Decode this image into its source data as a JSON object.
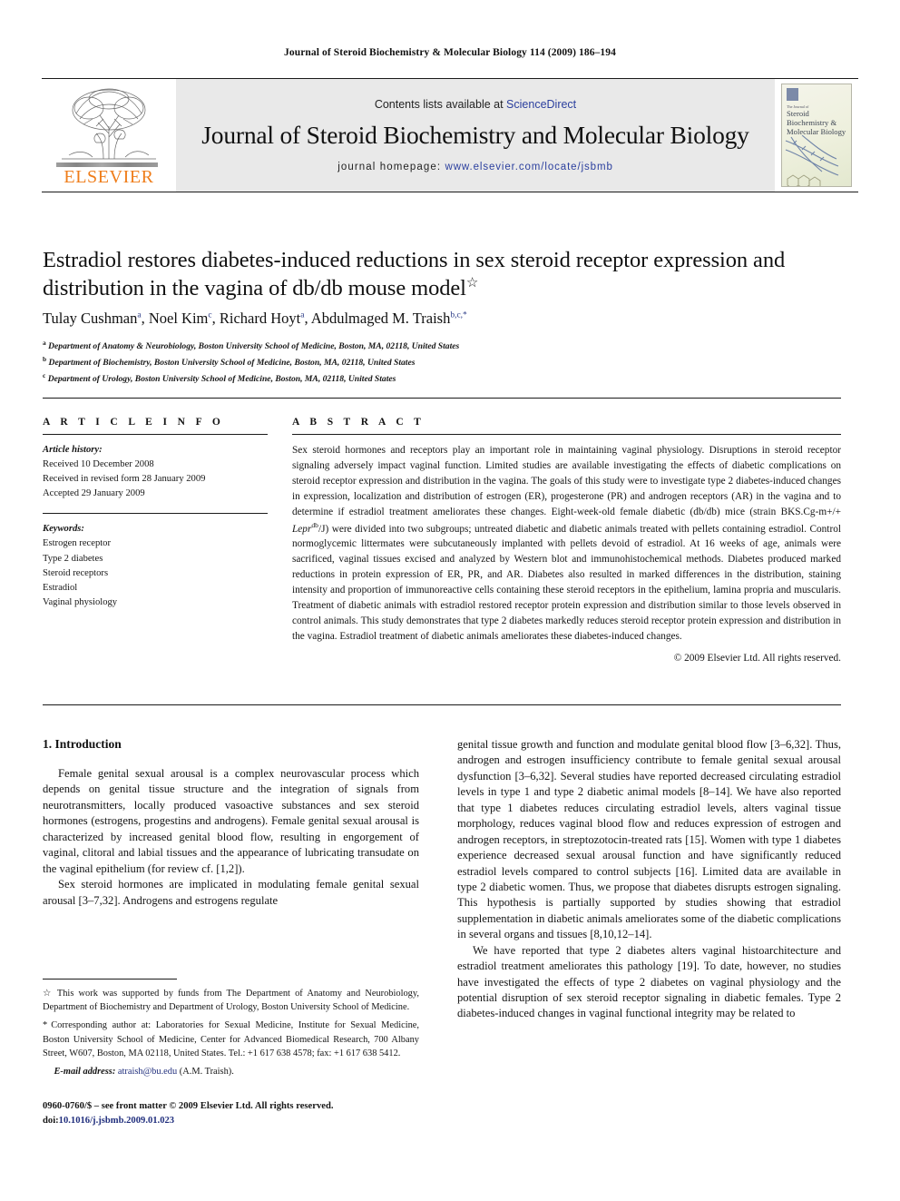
{
  "running_head": "Journal of Steroid Biochemistry & Molecular Biology 114 (2009) 186–194",
  "masthead": {
    "publisher": "ELSEVIER",
    "contents_prefix": "Contents lists available at ",
    "contents_link": "ScienceDirect",
    "journal_title": "Journal of Steroid Biochemistry and Molecular Biology",
    "homepage_prefix": "journal homepage: ",
    "homepage_url": "www.elsevier.com/locate/jsbmb",
    "cover": {
      "kicker": "The Journal of",
      "title": "Steroid Biochemistry & Molecular Biology"
    }
  },
  "article": {
    "title": "Estradiol restores diabetes-induced reductions in sex steroid receptor expression and distribution in the vagina of db/db mouse model",
    "title_footnote_marker": "☆",
    "authors": [
      {
        "name": "Tulay Cushman",
        "sup": "a"
      },
      {
        "name": "Noel Kim",
        "sup": "c"
      },
      {
        "name": "Richard Hoyt",
        "sup": "a"
      },
      {
        "name": "Abdulmaged M. Traish",
        "sup": "b,c,*"
      }
    ],
    "affiliations": [
      {
        "marker": "a",
        "text": "Department of Anatomy & Neurobiology, Boston University School of Medicine, Boston, MA, 02118, United States"
      },
      {
        "marker": "b",
        "text": "Department of Biochemistry, Boston University School of Medicine, Boston, MA, 02118, United States"
      },
      {
        "marker": "c",
        "text": "Department of Urology, Boston University School of Medicine, Boston, MA, 02118, United States"
      }
    ]
  },
  "article_info": {
    "heading": "A R T I C L E   I N F O",
    "history_label": "Article history:",
    "history": [
      "Received 10 December 2008",
      "Received in revised form 28 January 2009",
      "Accepted 29 January 2009"
    ],
    "keywords_label": "Keywords:",
    "keywords": [
      "Estrogen receptor",
      "Type 2 diabetes",
      "Steroid receptors",
      "Estradiol",
      "Vaginal physiology"
    ]
  },
  "abstract": {
    "heading": "A B S T R A C T",
    "part1": "Sex steroid hormones and receptors play an important role in maintaining vaginal physiology. Disruptions in steroid receptor signaling adversely impact vaginal function. Limited studies are available investigating the effects of diabetic complications on steroid receptor expression and distribution in the vagina. The goals of this study were to investigate type 2 diabetes-induced changes in expression, localization and distribution of estrogen (ER), progesterone (PR) and androgen receptors (AR) in the vagina and to determine if estradiol treatment ameliorates these changes. Eight-week-old female diabetic (db/db) mice (strain BKS.Cg-m+/+ ",
    "strain_italic": "Lepr",
    "strain_sup": "db",
    "part2": "/J) were divided into two subgroups; untreated diabetic and diabetic animals treated with pellets containing estradiol. Control normoglycemic littermates were subcutaneously implanted with pellets devoid of estradiol. At 16 weeks of age, animals were sacrificed, vaginal tissues excised and analyzed by Western blot and immunohistochemical methods. Diabetes produced marked reductions in protein expression of ER, PR, and AR. Diabetes also resulted in marked differences in the distribution, staining intensity and proportion of immunoreactive cells containing these steroid receptors in the epithelium, lamina propria and muscularis. Treatment of diabetic animals with estradiol restored receptor protein expression and distribution similar to those levels observed in control animals. This study demonstrates that type 2 diabetes markedly reduces steroid receptor protein expression and distribution in the vagina. Estradiol treatment of diabetic animals ameliorates these diabetes-induced changes.",
    "copyright": "© 2009 Elsevier Ltd. All rights reserved."
  },
  "body": {
    "section_number_title": "1.  Introduction",
    "left_paragraphs": [
      "Female genital sexual arousal is a complex neurovascular process which depends on genital tissue structure and the integration of signals from neurotransmitters, locally produced vasoactive substances and sex steroid hormones (estrogens, progestins and androgens). Female genital sexual arousal is characterized by increased genital blood flow, resulting in engorgement of vaginal, clitoral and labial tissues and the appearance of lubricating transudate on the vaginal epithelium (for review cf. [1,2]).",
      "Sex steroid hormones are implicated in modulating female genital sexual arousal [3–7,32]. Androgens and estrogens regulate"
    ],
    "right_paragraphs": [
      "genital tissue growth and function and modulate genital blood flow [3–6,32]. Thus, androgen and estrogen insufficiency contribute to female genital sexual arousal dysfunction [3–6,32]. Several studies have reported decreased circulating estradiol levels in type 1 and type 2 diabetic animal models [8–14]. We have also reported that type 1 diabetes reduces circulating estradiol levels, alters vaginal tissue morphology, reduces vaginal blood flow and reduces expression of estrogen and androgen receptors, in streptozotocin-treated rats [15]. Women with type 1 diabetes experience decreased sexual arousal function and have significantly reduced estradiol levels compared to control subjects [16]. Limited data are available in type 2 diabetic women. Thus, we propose that diabetes disrupts estrogen signaling. This hypothesis is partially supported by studies showing that estradiol supplementation in diabetic animals ameliorates some of the diabetic complications in several organs and tissues [8,10,12–14].",
      "We have reported that type 2 diabetes alters vaginal histoarchitecture and estradiol treatment ameliorates this pathology [19]. To date, however, no studies have investigated the effects of type 2 diabetes on vaginal physiology and the potential disruption of sex steroid receptor signaling in diabetic females. Type 2 diabetes-induced changes in vaginal functional integrity may be related to"
    ]
  },
  "footnotes": {
    "funding_marker": "☆",
    "funding": "This work was supported by funds from The Department of Anatomy and Neurobiology, Department of Biochemistry and Department of Urology, Boston University School of Medicine.",
    "corresponding_marker": "*",
    "corresponding": "Corresponding author at: Laboratories for Sexual Medicine, Institute for Sexual Medicine, Boston University School of Medicine, Center for Advanced Biomedical Research, 700 Albany Street, W607, Boston, MA 02118, United States. Tel.: +1 617 638 4578; fax: +1 617 638 5412.",
    "email_label": "E-mail address:",
    "email": "atraish@bu.edu",
    "email_suffix": "(A.M. Traish)."
  },
  "imprint": {
    "issn_line": "0960-0760/$ – see front matter © 2009 Elsevier Ltd. All rights reserved.",
    "doi_label": "doi:",
    "doi_value": "10.1016/j.jsbmb.2009.01.023"
  },
  "colors": {
    "link": "#22307e",
    "elsevier_orange": "#ef7d1a",
    "masthead_grey": "#e9e9e9"
  }
}
